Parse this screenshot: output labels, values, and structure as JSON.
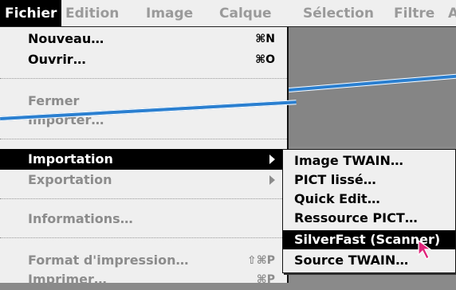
{
  "menubar": {
    "items": [
      {
        "label": "Fichier",
        "active": true
      },
      {
        "label": "Edition"
      },
      {
        "label": "Image"
      },
      {
        "label": "Calque"
      },
      {
        "label": "Sélection"
      },
      {
        "label": "Filtre"
      },
      {
        "label": "A"
      }
    ]
  },
  "fichier_menu": {
    "items": [
      {
        "label": "Nouveau…",
        "shortcut": "⌘N",
        "state": "enabled"
      },
      {
        "label": "Ouvrir…",
        "shortcut": "⌘O",
        "state": "enabled"
      },
      {
        "label": "Fermer",
        "state": "disabled"
      },
      {
        "label": "Importer…",
        "state": "disabled"
      },
      {
        "label": "Importation",
        "state": "highlighted",
        "submenu": true
      },
      {
        "label": "Exportation",
        "state": "disabled",
        "submenu": true
      },
      {
        "label": "Informations…",
        "state": "disabled"
      },
      {
        "label": "Format d'impression…",
        "shortcut": "⇧⌘P",
        "state": "disabled"
      },
      {
        "label": "Imprimer…",
        "shortcut": "⌘P",
        "state": "disabled"
      }
    ]
  },
  "import_submenu": {
    "items": [
      {
        "label": "Image TWAIN…"
      },
      {
        "label": "PICT lissé…"
      },
      {
        "label": "Quick Edit…"
      },
      {
        "label": "Ressource PICT…"
      },
      {
        "label": "SilverFast (Scanner)",
        "highlighted": true
      },
      {
        "label": "Source TWAIN…"
      }
    ]
  },
  "colors": {
    "line": "#2a7fd0",
    "cursor": "#e0237a",
    "highlight": "#000000"
  }
}
